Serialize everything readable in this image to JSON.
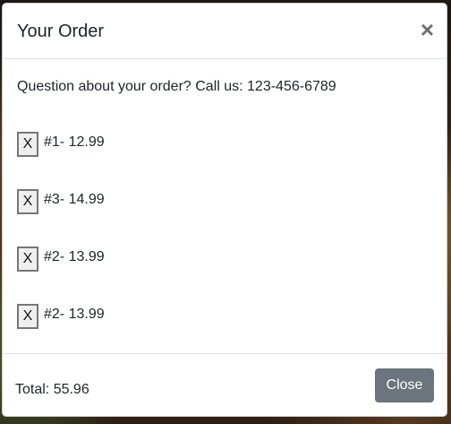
{
  "modal": {
    "title": "Your Order",
    "close_icon": "×",
    "help_text": "Question about your order? Call us: 123-456-6789",
    "items": [
      {
        "remove_label": "X",
        "text": "#1- 12.99"
      },
      {
        "remove_label": "X",
        "text": "#3- 14.99"
      },
      {
        "remove_label": "X",
        "text": "#2- 13.99"
      },
      {
        "remove_label": "X",
        "text": "#2- 13.99"
      }
    ],
    "total": "Total: 55.96",
    "close_button": "Close"
  },
  "colors": {
    "close_button_bg": "#6c757d",
    "divider": "#dee2e6",
    "text": "#212529"
  },
  "icons": {
    "header_close": "close-icon"
  }
}
